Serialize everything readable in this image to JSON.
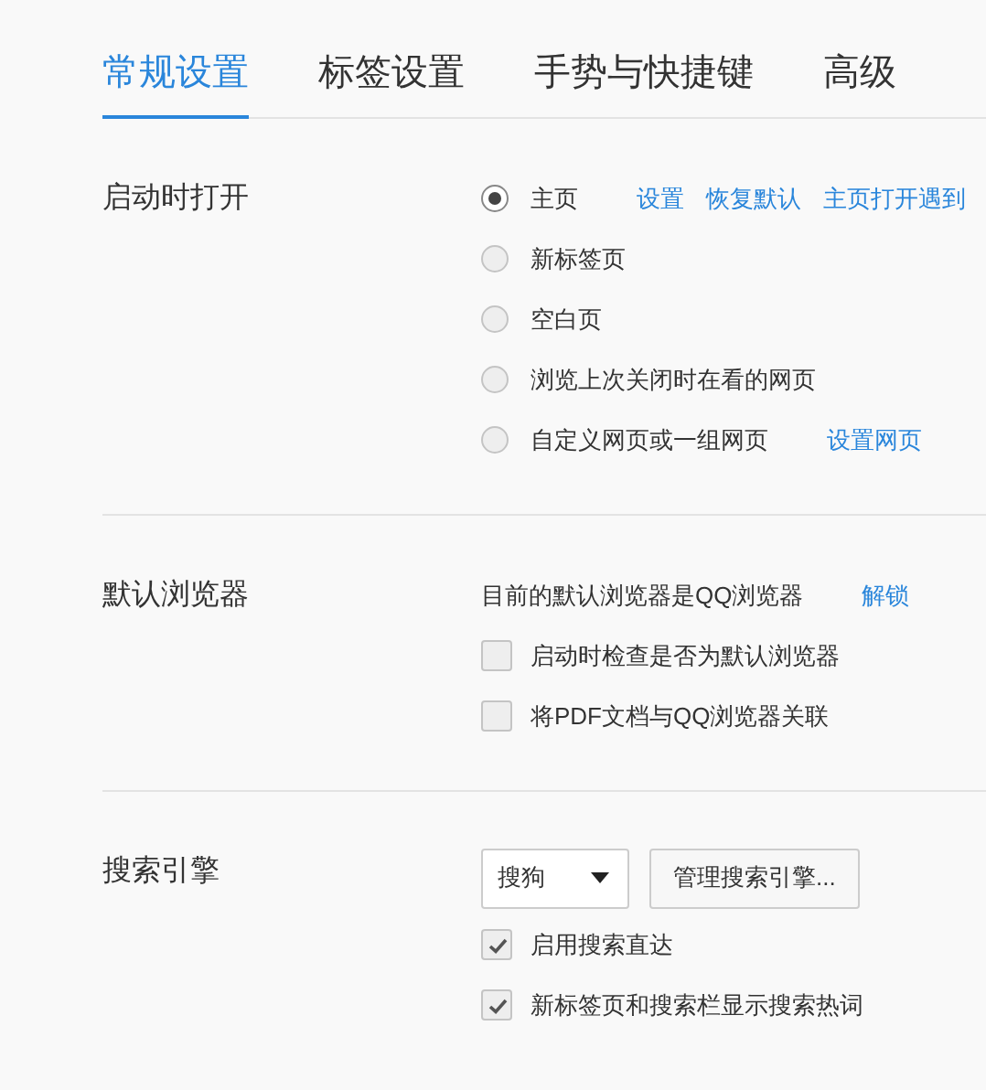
{
  "tabs": [
    {
      "label": "常规设置",
      "selected": true
    },
    {
      "label": "标签设置",
      "selected": false
    },
    {
      "label": "手势与快捷键",
      "selected": false
    },
    {
      "label": "高级",
      "selected": false
    }
  ],
  "sections": [
    {
      "label": "启动时打开",
      "items": [
        {
          "kind": "radio",
          "label": "主页",
          "selected": true,
          "links": [
            "设置",
            "恢复默认",
            "主页打开遇到"
          ]
        },
        {
          "kind": "radio",
          "label": "新标签页",
          "selected": false
        },
        {
          "kind": "radio",
          "label": "空白页",
          "selected": false
        },
        {
          "kind": "radio",
          "label": "浏览上次关闭时在看的网页",
          "selected": false
        },
        {
          "kind": "radio",
          "label": "自定义网页或一组网页",
          "selected": false,
          "links": [
            "设置网页"
          ]
        }
      ]
    },
    {
      "label": "默认浏览器",
      "items": [
        {
          "kind": "text",
          "label": "目前的默认浏览器是QQ浏览器",
          "links": [
            "解锁"
          ]
        },
        {
          "kind": "checkbox",
          "label": "启动时检查是否为默认浏览器",
          "checked": false
        },
        {
          "kind": "checkbox",
          "label": "将PDF文档与QQ浏览器关联",
          "checked": false
        }
      ]
    },
    {
      "label": "搜索引擎",
      "items": [
        {
          "kind": "controls",
          "dropdown": {
            "value": "搜狗"
          },
          "button": "管理搜索引擎..."
        },
        {
          "kind": "checkbox",
          "label": "启用搜索直达",
          "checked": true
        },
        {
          "kind": "checkbox",
          "label": "新标签页和搜索栏显示搜索热词",
          "checked": true
        }
      ]
    }
  ]
}
